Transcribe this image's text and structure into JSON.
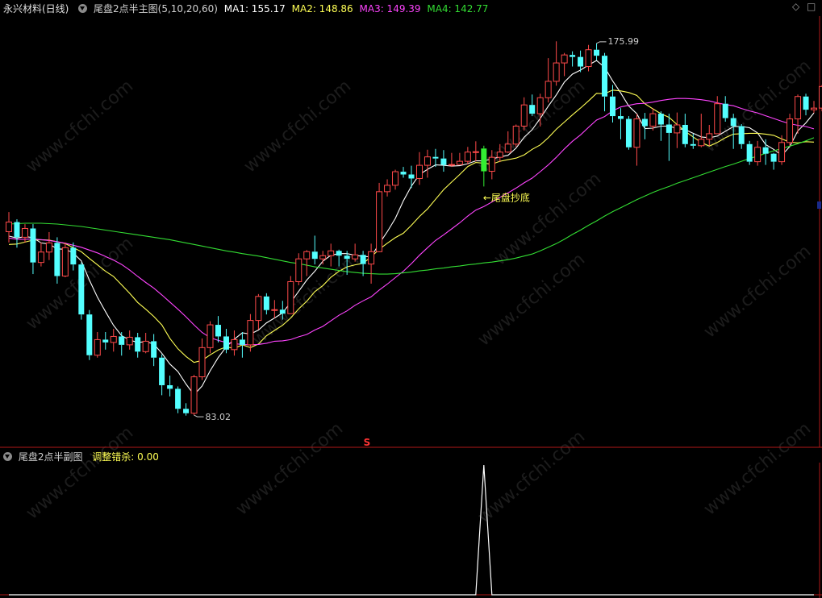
{
  "main_header": {
    "stock": "永兴材料(日线)",
    "indicator": "尾盘2点半主图(5,10,20,60)",
    "ma1": "MA1: 155.17",
    "ma2": "MA2: 148.86",
    "ma3": "MA3: 149.39",
    "ma4": "MA4: 142.77"
  },
  "sub_header": {
    "indicator": "尾盘2点半副图",
    "value": "调整错杀: 0.00"
  },
  "colors": {
    "up": "#ff4a4a",
    "down": "#54ffff",
    "ma1": "#ffffff",
    "ma2": "#ffff55",
    "ma3": "#ff44ff",
    "ma4": "#33dd33",
    "signal": "#33ee33",
    "axis": "#b01818"
  },
  "watermark": "www.cfchi.com",
  "marker_s": "S",
  "icons": [
    "chevron-down-icon",
    "diamond-icon",
    "square-icon"
  ],
  "chart_data": [
    {
      "type": "candlestick",
      "title": "尾盘2点半主图(5,10,20,60)",
      "ylim": [
        78,
        182
      ],
      "annotations": {
        "high_label": "175.99",
        "high_value": 175.99,
        "high_index": 73,
        "low_label": "83.02",
        "low_value": 83.02,
        "low_index": 23,
        "signal_label": "←尾盘抄底",
        "signal_index": 59
      },
      "candles": [
        [
          128.9,
          131.3,
          133.8,
          126.2
        ],
        [
          131.3,
          127.5,
          132.0,
          124.9
        ],
        [
          127.5,
          129.7,
          130.8,
          126.2
        ],
        [
          129.7,
          121.2,
          130.8,
          118.3
        ],
        [
          121.2,
          123.8,
          126.2,
          120.2
        ],
        [
          123.8,
          126.1,
          128.8,
          121.8
        ],
        [
          126.1,
          117.8,
          127.5,
          115.9
        ],
        [
          117.8,
          124.9,
          126.2,
          117.5
        ],
        [
          124.9,
          120.7,
          126.2,
          119.2
        ],
        [
          120.7,
          108.2,
          121.2,
          106.9
        ],
        [
          108.2,
          98.0,
          109.3,
          96.8
        ],
        [
          98.0,
          101.9,
          103.8,
          97.4
        ],
        [
          101.9,
          101.2,
          103.8,
          99.4
        ],
        [
          101.2,
          102.7,
          104.6,
          98.9
        ],
        [
          102.7,
          100.6,
          103.8,
          97.9
        ],
        [
          100.6,
          102.5,
          104.2,
          99.4
        ],
        [
          102.5,
          98.9,
          103.6,
          97.4
        ],
        [
          98.9,
          101.5,
          103.6,
          98.5
        ],
        [
          101.5,
          97.4,
          103.3,
          95.3
        ],
        [
          97.4,
          90.5,
          98.2,
          88.0
        ],
        [
          90.5,
          89.6,
          92.9,
          87.7
        ],
        [
          89.6,
          84.6,
          90.2,
          83.5
        ],
        [
          84.6,
          83.5,
          86.0,
          82.9
        ],
        [
          83.5,
          92.6,
          93.1,
          83.0
        ],
        [
          92.6,
          99.9,
          102.2,
          91.8
        ],
        [
          99.9,
          105.6,
          106.5,
          98.5
        ],
        [
          105.6,
          102.7,
          107.8,
          101.2
        ],
        [
          102.7,
          99.4,
          104.6,
          98.5
        ],
        [
          99.4,
          101.9,
          104.2,
          97.9
        ],
        [
          101.9,
          100.6,
          103.8,
          97.4
        ],
        [
          100.6,
          106.7,
          108.3,
          98.9
        ],
        [
          106.7,
          112.7,
          113.3,
          104.4
        ],
        [
          112.7,
          109.3,
          113.5,
          108.2
        ],
        [
          109.3,
          109.4,
          111.8,
          107.3
        ],
        [
          109.4,
          108.4,
          111.6,
          106.9
        ],
        [
          108.4,
          116.4,
          117.8,
          108.5
        ],
        [
          116.4,
          122.1,
          123.5,
          115.5
        ],
        [
          122.1,
          123.9,
          124.3,
          117.8
        ],
        [
          123.9,
          122.1,
          127.9,
          120.7
        ],
        [
          122.1,
          122.9,
          124.1,
          120.7
        ],
        [
          122.9,
          124.1,
          125.9,
          120.2
        ],
        [
          124.1,
          122.9,
          124.4,
          120.2
        ],
        [
          122.9,
          122.1,
          124.1,
          118.1
        ],
        [
          122.1,
          123.1,
          125.9,
          121.4
        ],
        [
          123.1,
          120.8,
          124.1,
          117.8
        ],
        [
          120.8,
          123.9,
          125.9,
          115.9
        ],
        [
          123.9,
          138.9,
          141.1,
          123.8
        ],
        [
          138.9,
          140.5,
          142.0,
          137.7
        ],
        [
          140.5,
          143.9,
          144.4,
          139.4
        ],
        [
          143.9,
          143.2,
          145.1,
          142.4
        ],
        [
          143.2,
          142.2,
          145.4,
          139.8
        ],
        [
          142.2,
          145.5,
          148.8,
          140.6
        ],
        [
          145.5,
          147.6,
          149.4,
          142.4
        ],
        [
          147.6,
          147.2,
          149.6,
          145.1
        ],
        [
          147.2,
          145.6,
          149.3,
          143.9
        ],
        [
          145.6,
          145.7,
          148.6,
          145.1
        ],
        [
          145.7,
          146.5,
          148.6,
          145.7
        ],
        [
          146.5,
          148.8,
          150.1,
          145.7
        ],
        [
          148.8,
          148.9,
          151.5,
          146.5
        ],
        [
          149.7,
          144.0,
          150.4,
          140.2
        ],
        [
          144.0,
          147.5,
          149.3,
          142.0
        ],
        [
          147.5,
          148.8,
          150.8,
          146.3
        ],
        [
          148.8,
          150.8,
          154.0,
          148.6
        ],
        [
          150.8,
          155.3,
          155.7,
          150.1
        ],
        [
          155.3,
          160.6,
          162.5,
          154.2
        ],
        [
          160.6,
          158.4,
          163.2,
          157.8
        ],
        [
          158.4,
          162.4,
          163.4,
          155.2
        ],
        [
          162.4,
          166.5,
          172.3,
          161.2
        ],
        [
          166.5,
          171.1,
          176.5,
          165.4
        ],
        [
          171.1,
          173.1,
          173.6,
          167.8
        ],
        [
          173.1,
          172.6,
          174.0,
          170.2
        ],
        [
          172.6,
          170.2,
          174.2,
          168.8
        ],
        [
          170.2,
          174.4,
          175.6,
          169.0
        ],
        [
          174.4,
          172.9,
          176.0,
          171.8
        ],
        [
          172.9,
          162.7,
          173.6,
          159.0
        ],
        [
          162.7,
          157.8,
          165.6,
          156.2
        ],
        [
          157.8,
          157.1,
          159.8,
          152.0
        ],
        [
          157.1,
          150.0,
          157.8,
          149.4
        ],
        [
          150.0,
          157.1,
          158.4,
          145.4
        ],
        [
          157.1,
          155.3,
          158.6,
          152.0
        ],
        [
          155.3,
          158.4,
          159.8,
          154.2
        ],
        [
          158.4,
          155.7,
          159.0,
          151.6
        ],
        [
          155.7,
          153.6,
          158.4,
          146.6
        ],
        [
          153.6,
          155.6,
          158.7,
          149.8
        ],
        [
          155.6,
          150.8,
          158.4,
          150.0
        ],
        [
          150.8,
          150.4,
          153.4,
          149.6
        ],
        [
          150.4,
          152.0,
          158.4,
          150.0
        ],
        [
          152.0,
          153.4,
          155.6,
          150.4
        ],
        [
          153.4,
          160.9,
          162.8,
          153.4
        ],
        [
          160.9,
          157.3,
          162.8,
          156.4
        ],
        [
          157.3,
          155.3,
          158.4,
          149.6
        ],
        [
          155.3,
          150.8,
          155.8,
          149.6
        ],
        [
          150.8,
          146.4,
          151.6,
          145.6
        ],
        [
          146.4,
          150.0,
          151.6,
          145.4
        ],
        [
          150.0,
          148.4,
          152.0,
          145.6
        ],
        [
          148.4,
          146.4,
          148.6,
          144.4
        ],
        [
          146.4,
          151.2,
          153.0,
          145.6
        ],
        [
          151.2,
          157.1,
          158.4,
          150.4
        ],
        [
          157.1,
          162.7,
          163.2,
          153.4
        ],
        [
          162.7,
          159.4,
          163.4,
          158.0
        ],
        [
          159.4,
          159.8,
          161.6,
          158.6
        ],
        [
          159.8,
          165.2,
          165.6,
          159.0
        ]
      ],
      "series": [
        {
          "name": "MA1",
          "values": [
            127.8,
            127.3,
            127.7,
            127.4,
            126.1,
            125.8,
            124.6,
            124.5,
            123.6,
            121.6,
            116.8,
            112.5,
            108.9,
            105.5,
            102.9,
            101.8,
            101.2,
            101.4,
            100.8,
            98.5,
            95.8,
            93.9,
            90.8,
            88.1,
            90.3,
            94.1,
            97.4,
            100.1,
            102.0,
            103.6,
            103.3,
            104.3,
            106.1,
            107.3,
            108.6,
            111.2,
            114.0,
            116.8,
            119.0,
            121.5,
            123.0,
            123.4,
            123.4,
            123.0,
            122.7,
            122.6,
            125.9,
            128.9,
            132.2,
            136.6,
            140.3,
            143.2,
            144.5,
            145.6,
            145.5,
            145.3,
            145.4,
            145.9,
            146.6,
            146.6,
            147.1,
            147.6,
            148.0,
            149.8,
            152.5,
            154.4,
            157.2,
            160.3,
            163.1,
            166.3,
            168.3,
            169.3,
            170.6,
            171.7,
            170.0,
            166.6,
            163.6,
            160.3,
            158.4,
            154.7,
            154.8,
            155.3,
            155.3,
            154.7,
            154.4,
            153.5,
            152.6,
            152.4,
            152.8,
            154.0,
            155.2,
            155.2,
            154.9,
            153.6,
            150.7,
            149.5,
            148.0,
            150.2,
            154.1,
            156.1,
            158.6
          ]
        },
        {
          "name": "MA2",
          "values": [
            125.7,
            125.8,
            126.3,
            126.8,
            126.9,
            126.8,
            126.4,
            125.9,
            124.9,
            123.9,
            122.2,
            120.6,
            119.0,
            117.7,
            115.6,
            113.5,
            111.2,
            109.5,
            107.7,
            105.6,
            102.2,
            99.6,
            97.7,
            96.2,
            96.7,
            98.1,
            99.3,
            100.1,
            99.7,
            100.6,
            99.9,
            100.8,
            102.9,
            104.2,
            105.5,
            107.3,
            109.6,
            111.5,
            113.9,
            115.4,
            117.5,
            119.0,
            120.1,
            120.6,
            121.0,
            122.6,
            124.5,
            126.0,
            127.4,
            128.5,
            130.5,
            132.7,
            134.6,
            137.0,
            139.4,
            141.3,
            143.2,
            145.2,
            146.2,
            146.0,
            145.8,
            146.5,
            146.9,
            147.3,
            148.1,
            149.5,
            150.6,
            152.4,
            154.5,
            156.3,
            158.1,
            159.8,
            161.6,
            163.5,
            163.4,
            164.3,
            164.1,
            163.7,
            163.0,
            160.9,
            159.6,
            158.4,
            157.5,
            155.7,
            154.0,
            152.6,
            151.2,
            150.3,
            151.2,
            152.4,
            153.3,
            153.4,
            153.5,
            153.5,
            153.3,
            153.0,
            152.1,
            151.3,
            151.1,
            151.4,
            151.3
          ]
        },
        {
          "name": "MA3",
          "values": [
            127.3,
            127.0,
            127.0,
            127.1,
            126.9,
            126.7,
            126.4,
            126.0,
            125.5,
            125.0,
            124.3,
            123.6,
            122.7,
            121.8,
            120.7,
            119.3,
            117.7,
            116.2,
            114.8,
            113.1,
            111.3,
            109.5,
            107.6,
            105.6,
            103.7,
            102.4,
            101.7,
            101.2,
            100.9,
            100.7,
            100.6,
            100.7,
            101.0,
            101.5,
            101.6,
            101.9,
            102.6,
            103.2,
            104.3,
            105.2,
            106.6,
            108.0,
            109.1,
            110.5,
            111.6,
            112.6,
            114.3,
            115.8,
            117.4,
            119.0,
            120.9,
            123.0,
            124.9,
            126.7,
            128.1,
            129.6,
            131.1,
            132.8,
            134.3,
            135.2,
            136.3,
            137.5,
            138.6,
            139.8,
            141.1,
            142.3,
            143.9,
            145.6,
            147.5,
            149.6,
            151.5,
            153.1,
            155.0,
            156.8,
            157.7,
            159.1,
            160.1,
            160.5,
            160.9,
            161.0,
            161.3,
            161.7,
            162.0,
            162.2,
            162.2,
            162.1,
            161.9,
            161.6,
            161.1,
            160.7,
            160.4,
            159.7,
            159.1,
            158.6,
            157.9,
            157.2,
            156.5,
            155.9,
            155.5,
            155.2,
            154.6
          ]
        },
        {
          "name": "MA4",
          "values": [
            130.8,
            130.9,
            131.0,
            131.0,
            131.0,
            130.9,
            130.8,
            130.6,
            130.4,
            130.2,
            129.9,
            129.6,
            129.3,
            129.0,
            128.7,
            128.4,
            128.1,
            127.8,
            127.5,
            127.2,
            126.9,
            126.5,
            126.1,
            125.7,
            125.3,
            124.9,
            124.5,
            124.1,
            123.8,
            123.4,
            123.1,
            122.8,
            122.4,
            122.0,
            121.6,
            121.2,
            120.9,
            120.5,
            120.1,
            119.8,
            119.5,
            119.2,
            118.9,
            118.7,
            118.5,
            118.4,
            118.3,
            118.3,
            118.4,
            118.6,
            118.8,
            119.1,
            119.3,
            119.6,
            119.8,
            120.1,
            120.3,
            120.6,
            120.8,
            121.1,
            121.3,
            121.6,
            121.9,
            122.3,
            122.8,
            123.3,
            124.1,
            125.0,
            125.9,
            127.0,
            128.2,
            129.3,
            130.5,
            131.6,
            132.8,
            133.9,
            134.9,
            135.9,
            136.9,
            137.8,
            138.7,
            139.5,
            140.2,
            141.0,
            141.7,
            142.4,
            143.1,
            143.8,
            144.5,
            145.2,
            145.8,
            146.5,
            147.2,
            147.8,
            148.5,
            149.1,
            149.7,
            150.3,
            150.9,
            151.6,
            152.4
          ]
        }
      ]
    },
    {
      "type": "line",
      "title": "调整错杀",
      "ylim": [
        0,
        1
      ],
      "series": [
        {
          "name": "调整错杀",
          "x": [
            0,
            58,
            59,
            60,
            100
          ],
          "values": [
            0,
            0,
            1,
            0,
            0
          ]
        }
      ]
    }
  ]
}
